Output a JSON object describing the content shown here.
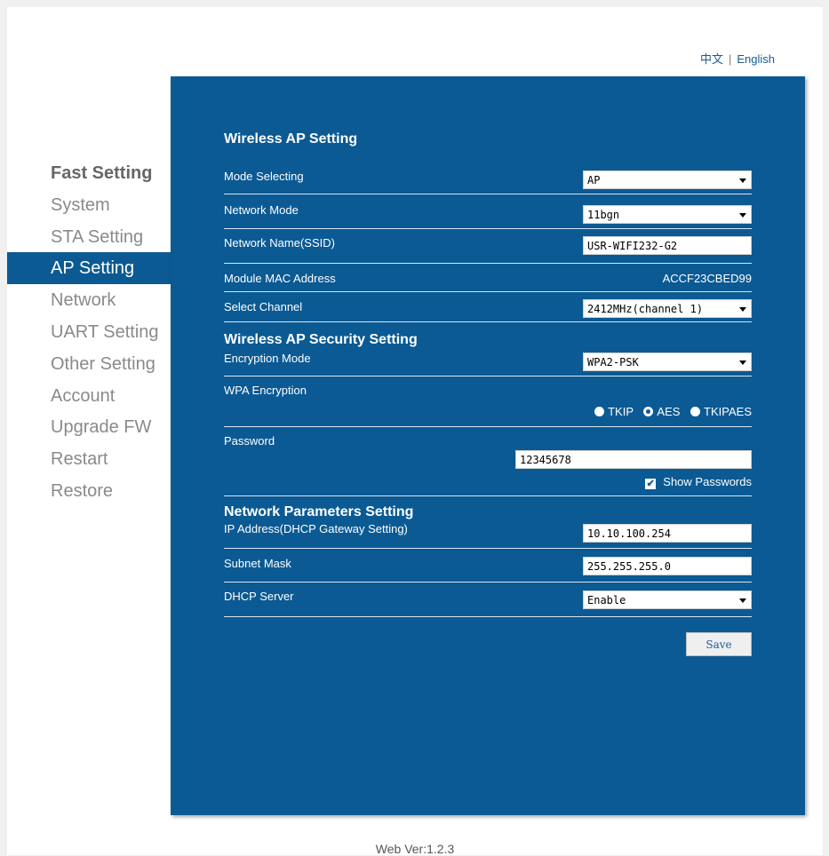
{
  "lang": {
    "chinese": "中文",
    "english": "English",
    "separator": "|"
  },
  "sidebar": {
    "items": [
      {
        "label": "Fast Setting"
      },
      {
        "label": "System"
      },
      {
        "label": "STA Setting"
      },
      {
        "label": "AP Setting"
      },
      {
        "label": "Network"
      },
      {
        "label": "UART Setting"
      },
      {
        "label": "Other Setting"
      },
      {
        "label": "Account"
      },
      {
        "label": "Upgrade FW"
      },
      {
        "label": "Restart"
      },
      {
        "label": "Restore"
      }
    ]
  },
  "ap": {
    "title": "Wireless AP Setting",
    "mode": {
      "label": "Mode Selecting",
      "value": "AP"
    },
    "network_mode": {
      "label": "Network Mode",
      "value": "11bgn"
    },
    "ssid": {
      "label": "Network Name(SSID)",
      "value": "USR-WIFI232-G2"
    },
    "mac": {
      "label": "Module MAC Address",
      "value": "ACCF23CBED99"
    },
    "channel": {
      "label": "Select Channel",
      "value": "2412MHz(channel 1)"
    }
  },
  "security": {
    "title": "Wireless AP Security Setting",
    "encryption_mode": {
      "label": "Encryption Mode",
      "value": "WPA2-PSK"
    },
    "wpa": {
      "label": "WPA Encryption",
      "options": [
        "TKIP",
        "AES",
        "TKIPAES"
      ],
      "selected": "AES"
    },
    "password": {
      "label": "Password",
      "value": "12345678"
    },
    "show_passwords": {
      "label": "Show Passwords",
      "checked": true
    }
  },
  "network": {
    "title": "Network Parameters Setting",
    "ip": {
      "label": "IP Address(DHCP Gateway Setting)",
      "value": "10.10.100.254"
    },
    "mask": {
      "label": "Subnet Mask",
      "value": "255.255.255.0"
    },
    "dhcp": {
      "label": "DHCP Server",
      "value": "Enable"
    }
  },
  "save_label": "Save",
  "footer": "Web Ver:1.2.3",
  "colors": {
    "panel": "#0b5a94",
    "active_item": "#0b5a94",
    "sidebar_text": "#8a8a8a"
  }
}
